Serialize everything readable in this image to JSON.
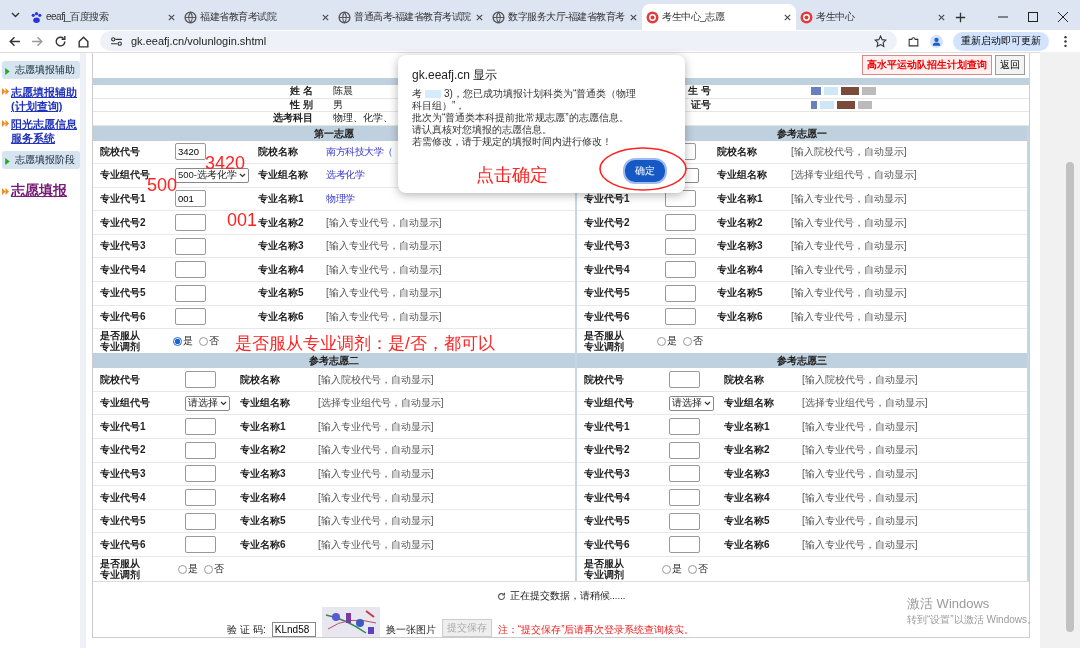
{
  "browser": {
    "tabs": [
      {
        "title": "eeafj_百度搜索",
        "selected": false
      },
      {
        "title": "福建省教育考试院",
        "selected": false
      },
      {
        "title": "普通高考-福建省教育考试院",
        "selected": false
      },
      {
        "title": "数字服务大厅-福建省教育考",
        "selected": false
      },
      {
        "title": "考生中心_志愿",
        "selected": true
      },
      {
        "title": "考生中心",
        "selected": false
      }
    ],
    "url": "gk.eeafj.cn/volunlogin.shtml",
    "update_button": "重新启动即可更新"
  },
  "sidebar": {
    "items": [
      {
        "kind": "section",
        "label": "志愿填报辅助"
      },
      {
        "kind": "link",
        "label": "志愿填报辅助(计划查询)"
      },
      {
        "kind": "link",
        "label": "阳光志愿信息服务系统"
      },
      {
        "kind": "section",
        "label": "志愿填报阶段"
      },
      {
        "kind": "main_link",
        "label": "志愿填报"
      }
    ]
  },
  "toolbar": {
    "buttons": [
      {
        "label": "高水平运动队招生计划查询",
        "kind": "highlight"
      },
      {
        "label": "返回",
        "kind": "plain"
      }
    ]
  },
  "student_info": {
    "rows": [
      {
        "label": "姓 名",
        "value": "陈晨",
        "right_label": "生 号"
      },
      {
        "label": "性 别",
        "value": "男",
        "right_label": "证号"
      },
      {
        "label": "选考科目",
        "value": "物理、化学、"
      }
    ]
  },
  "panels": [
    {
      "title": "第一志愿",
      "rows": [
        {
          "code_label": "院校代号",
          "kind": "input",
          "value": "3420",
          "name_label": "院校名称",
          "name": "南方科技大学（",
          "filled": true
        },
        {
          "code_label": "专业组代号",
          "kind": "select",
          "value": "500-选考化学",
          "name_label": "专业组名称",
          "name": "选考化学",
          "filled": true
        },
        {
          "code_label": "专业代号1",
          "kind": "input",
          "value": "001",
          "name_label": "专业名称1",
          "name": "物理学",
          "filled": true
        },
        {
          "code_label": "专业代号2",
          "kind": "input",
          "name_label": "专业名称2",
          "name": "[输入专业代号，自动显示]",
          "filled": false
        },
        {
          "code_label": "专业代号3",
          "kind": "input",
          "name_label": "专业名称3",
          "name": "[输入专业代号，自动显示]",
          "filled": false
        },
        {
          "code_label": "专业代号4",
          "kind": "input",
          "name_label": "专业名称4",
          "name": "[输入专业代号，自动显示]",
          "filled": false
        },
        {
          "code_label": "专业代号5",
          "kind": "input",
          "name_label": "专业名称5",
          "name": "[输入专业代号，自动显示]",
          "filled": false
        },
        {
          "code_label": "专业代号6",
          "kind": "input",
          "name_label": "专业名称6",
          "name": "[输入专业代号，自动显示]",
          "filled": false
        }
      ],
      "transfer": {
        "label": "是否服从专业调剂",
        "options": [
          {
            "label": "是",
            "selected": true
          },
          {
            "label": "否",
            "selected": false
          }
        ]
      }
    },
    {
      "title": "参考志愿一",
      "rows": [
        {
          "kind": "input",
          "name_label": "院校名称",
          "name": "[输入院校代号，自动显示]",
          "filled": false
        },
        {
          "kind": "select",
          "name_label": "专业组名称",
          "name": "[选择专业组代号，自动显示]",
          "filled": false
        },
        {
          "code_label": "专业代号1",
          "kind": "input",
          "name_label": "专业名称1",
          "name": "[输入专业代号，自动显示]",
          "filled": false
        },
        {
          "code_label": "专业代号2",
          "kind": "input",
          "name_label": "专业名称2",
          "name": "[输入专业代号，自动显示]",
          "filled": false
        },
        {
          "code_label": "专业代号3",
          "kind": "input",
          "name_label": "专业名称3",
          "name": "[输入专业代号，自动显示]",
          "filled": false
        },
        {
          "code_label": "专业代号4",
          "kind": "input",
          "name_label": "专业名称4",
          "name": "[输入专业代号，自动显示]",
          "filled": false
        },
        {
          "code_label": "专业代号5",
          "kind": "input",
          "name_label": "专业名称5",
          "name": "[输入专业代号，自动显示]",
          "filled": false
        },
        {
          "code_label": "专业代号6",
          "kind": "input",
          "name_label": "专业名称6",
          "name": "[输入专业代号，自动显示]",
          "filled": false
        }
      ],
      "transfer": {
        "label": "是否服从专业调剂",
        "options": [
          {
            "label": "是",
            "selected": false
          },
          {
            "label": "否",
            "selected": false
          }
        ]
      }
    },
    {
      "title": "参考志愿二",
      "rows": [
        {
          "code_label": "院校代号",
          "kind": "input",
          "name_label": "院校名称",
          "name": "[输入院校代号，自动显示]",
          "filled": false
        },
        {
          "code_label": "专业组代号",
          "kind": "select",
          "value": "请选择",
          "name_label": "专业组名称",
          "name": "[选择专业组代号，自动显示]",
          "filled": false
        },
        {
          "code_label": "专业代号1",
          "kind": "input",
          "name_label": "专业名称1",
          "name": "[输入专业代号，自动显示]",
          "filled": false
        },
        {
          "code_label": "专业代号2",
          "kind": "input",
          "name_label": "专业名称2",
          "name": "[输入专业代号，自动显示]",
          "filled": false
        },
        {
          "code_label": "专业代号3",
          "kind": "input",
          "name_label": "专业名称3",
          "name": "[输入专业代号，自动显示]",
          "filled": false
        },
        {
          "code_label": "专业代号4",
          "kind": "input",
          "name_label": "专业名称4",
          "name": "[输入专业代号，自动显示]",
          "filled": false
        },
        {
          "code_label": "专业代号5",
          "kind": "input",
          "name_label": "专业名称5",
          "name": "[输入专业代号，自动显示]",
          "filled": false
        },
        {
          "code_label": "专业代号6",
          "kind": "input",
          "name_label": "专业名称6",
          "name": "[输入专业代号，自动显示]",
          "filled": false
        }
      ],
      "transfer": {
        "label": "是否服从专业调剂",
        "options": [
          {
            "label": "是",
            "selected": false
          },
          {
            "label": "否",
            "selected": false
          }
        ]
      }
    },
    {
      "title": "参考志愿三",
      "rows": [
        {
          "code_label": "院校代号",
          "kind": "input",
          "name_label": "院校名称",
          "name": "[输入院校代号，自动显示]",
          "filled": false
        },
        {
          "code_label": "专业组代号",
          "kind": "select",
          "value": "请选择",
          "name_label": "专业组名称",
          "name": "[选择专业组代号，自动显示]",
          "filled": false
        },
        {
          "code_label": "专业代号1",
          "kind": "input",
          "name_label": "专业名称1",
          "name": "[输入专业代号，自动显示]",
          "filled": false
        },
        {
          "code_label": "专业代号2",
          "kind": "input",
          "name_label": "专业名称2",
          "name": "[输入专业代号，自动显示]",
          "filled": false
        },
        {
          "code_label": "专业代号3",
          "kind": "input",
          "name_label": "专业名称3",
          "name": "[输入专业代号，自动显示]",
          "filled": false
        },
        {
          "code_label": "专业代号4",
          "kind": "input",
          "name_label": "专业名称4",
          "name": "[输入专业代号，自动显示]",
          "filled": false
        },
        {
          "code_label": "专业代号5",
          "kind": "input",
          "name_label": "专业名称5",
          "name": "[输入专业代号，自动显示]",
          "filled": false
        },
        {
          "code_label": "专业代号6",
          "kind": "input",
          "name_label": "专业名称6",
          "name": "[输入专业代号，自动显示]",
          "filled": false
        }
      ],
      "transfer": {
        "label": "是否服从专业调剂",
        "options": [
          {
            "label": "是",
            "selected": false
          },
          {
            "label": "否",
            "selected": false
          }
        ]
      }
    }
  ],
  "footer": {
    "status": "正在提交数据，请稍候......",
    "captcha_label": "验 证 码:",
    "captcha_value": "KLnd58",
    "refresh_link": "换一张图片",
    "submit_button": "提交保存",
    "submit_disabled": true,
    "note": "注：“提交保存”后请再次登录系统查询核实。"
  },
  "dialog": {
    "origin": "gk.eeafj.cn 显示",
    "lead": "考",
    "lines": [
      "3)，您已成功填报计划科类为“普通类（物理",
      "科目组）”，",
      "批次为“普通类本科提前批常规志愿”的志愿信息。",
      "请认真核对您填报的志愿信息。",
      "若需修改，请于规定的填报时间内进行修改！"
    ],
    "button": "确定"
  },
  "annotations": [
    {
      "kind": "school_code",
      "text": "3420"
    },
    {
      "kind": "group_code",
      "text": "500"
    },
    {
      "kind": "major_code",
      "text": "001"
    },
    {
      "kind": "transfer",
      "text": "是否服从专业调剂：是/否，都可以"
    },
    {
      "kind": "confirm",
      "text": "点击确定"
    }
  ],
  "watermark": {
    "title": "激活 Windows",
    "hint": "转到“设置”以激活 Windows。"
  }
}
